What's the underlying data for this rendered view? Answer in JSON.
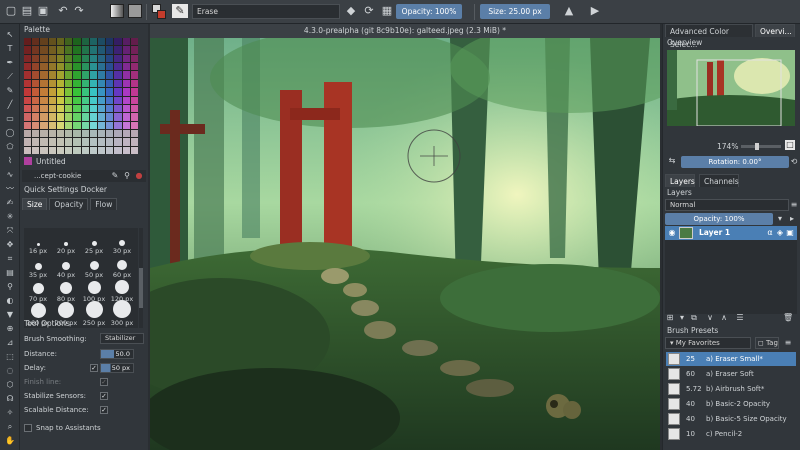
{
  "toolbar": {
    "blend_mode": "Erase",
    "opacity_label": "Opacity: 100%",
    "size_label": "Size: 25.00 px"
  },
  "document": {
    "title": "4.3.0-prealpha (git 8c9b10e): galteed.jpeg (2.3 MiB) *"
  },
  "left_dock": {
    "palette_title": "Palette",
    "palette_name": "Untitled",
    "brush_name": "...cept-cookie",
    "quick_settings_title": "Quick Settings Docker",
    "tabs": [
      "Size",
      "Opacity",
      "Flow"
    ],
    "sizes": [
      "16 px",
      "20 px",
      "25 px",
      "30 px",
      "35 px",
      "40 px",
      "50 px",
      "60 px",
      "70 px",
      "80 px",
      "100 px",
      "120 px",
      "160 px",
      "200 px",
      "250 px",
      "300 px"
    ],
    "tool_options_title": "Tool Options",
    "brush_smoothing_label": "Brush Smoothing:",
    "brush_smoothing_value": "Stabilizer",
    "distance_label": "Distance:",
    "distance_value": "50.0",
    "delay_label": "Delay:",
    "delay_value": "50 px",
    "finish_line_label": "Finish line:",
    "stabilize_sensors_label": "Stabilize Sensors:",
    "scalable_distance_label": "Scalable Distance:",
    "snap_label": "Snap to Assistants"
  },
  "right_dock": {
    "tab_color": "Advanced Color Selec...",
    "tab_overview": "Overvi...",
    "overview_title": "Overview",
    "zoom": "174%",
    "rotation": "Rotation: 0.00°",
    "tab_layers": "Layers",
    "tab_channels": "Channels",
    "layers_title": "Layers",
    "blend_mode": "Normal",
    "layer_opacity": "Opacity: 100%",
    "layer_name": "Layer 1",
    "brush_presets_title": "Brush Presets",
    "preset_filter": "My Favorites",
    "tag_label": "Tag",
    "presets": [
      {
        "num": "25",
        "name": "a) Eraser Small*"
      },
      {
        "num": "60",
        "name": "a) Eraser Soft"
      },
      {
        "num": "5.72",
        "name": "b) Airbrush Soft*"
      },
      {
        "num": "40",
        "name": "b) Basic-2 Opacity"
      },
      {
        "num": "40",
        "name": "b) Basic-5 Size Opacity"
      },
      {
        "num": "10",
        "name": "c) Pencil-2"
      }
    ]
  },
  "colors": {
    "accent": "#4a7fb5",
    "panel": "#31363b",
    "toolbar": "#3b4045"
  }
}
